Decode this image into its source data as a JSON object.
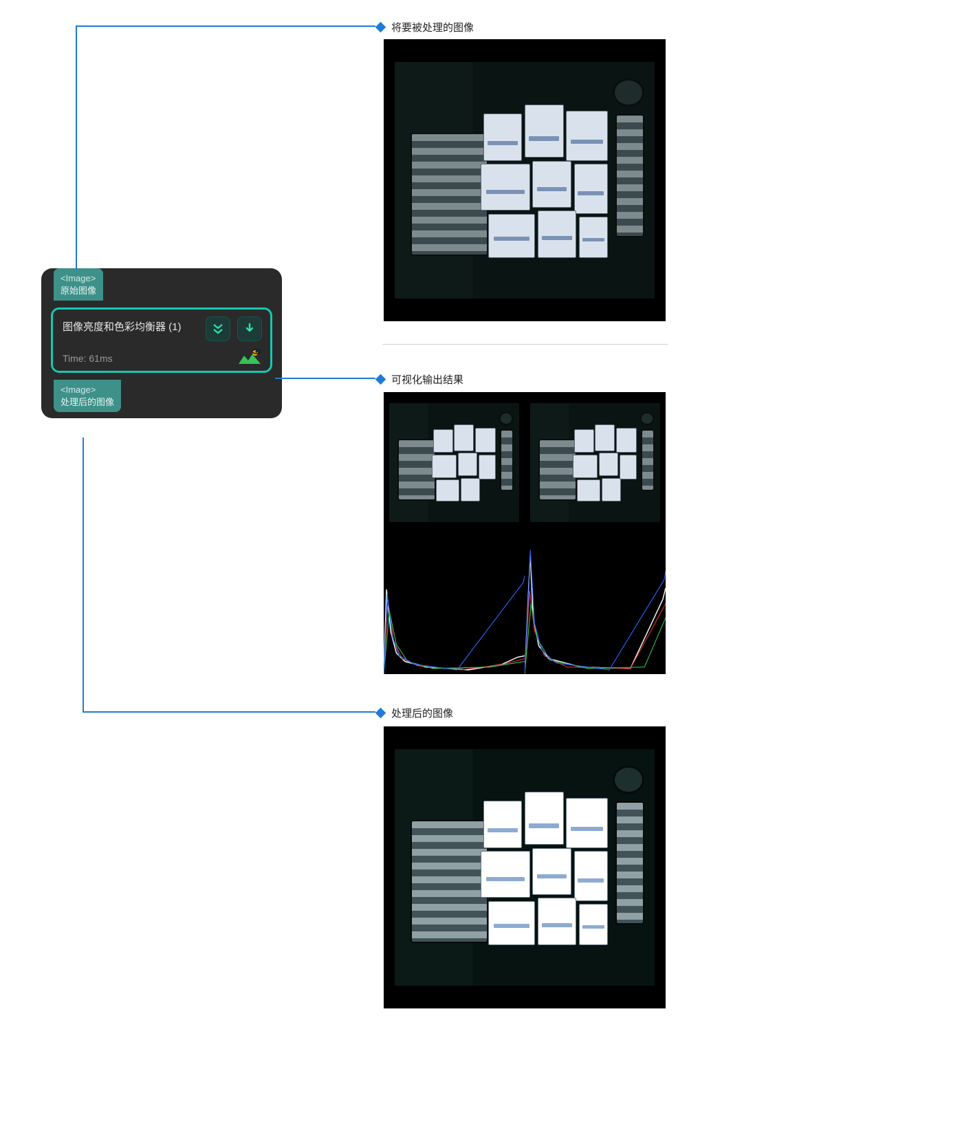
{
  "node": {
    "input_port": {
      "type": "<Image>",
      "name": "原始图像"
    },
    "title": "图像亮度和色彩均衡器 (1)",
    "time_label": "Time: 61ms",
    "output_port": {
      "type": "<Image>",
      "name": "处理后的图像"
    },
    "buttons": {
      "expand": "expand",
      "download": "download"
    },
    "vis_icon": "visual-output"
  },
  "callouts": {
    "input": "将要被处理的图像",
    "visual": "可视化输出结果",
    "output": "处理后的图像"
  },
  "colors": {
    "connector": "#1e7bd6",
    "node_border": "#15c9b4",
    "port_bg": "#3d9188"
  }
}
